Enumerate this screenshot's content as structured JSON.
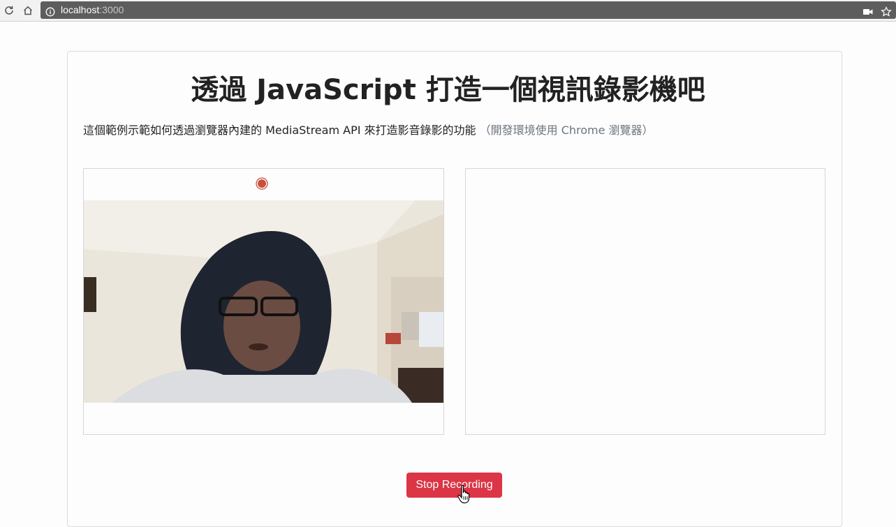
{
  "browser": {
    "url_host": "localhost",
    "url_port": ":3000",
    "icons": [
      "reload-icon",
      "home-icon",
      "info-icon",
      "camera-icon",
      "star-icon"
    ]
  },
  "page": {
    "title": "透過 JavaScript 打造一個視訊錄影機吧",
    "description": "這個範例示範如何透過瀏覽器內建的 MediaStream API 來打造影音錄影的功能",
    "description_note": "（開發環境使用 Chrome 瀏覽器）"
  },
  "recorder": {
    "stop_label": "Stop Recording",
    "recording_color": "#c9503c",
    "button_color": "#dc3545"
  }
}
